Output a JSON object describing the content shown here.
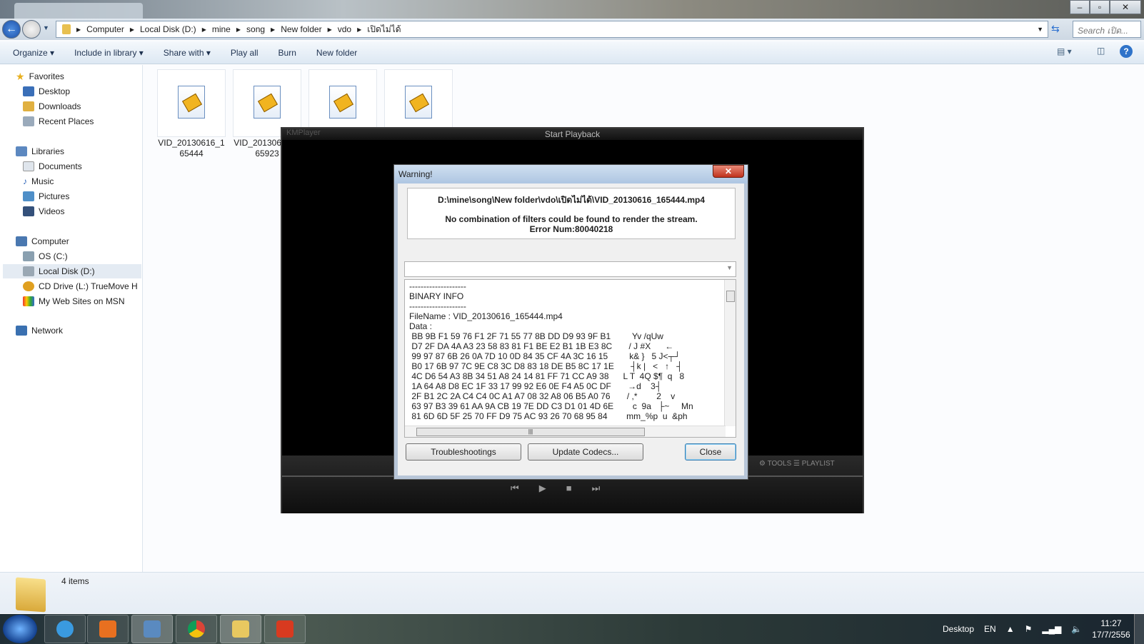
{
  "window": {
    "controls": [
      "minimize",
      "maximize",
      "close"
    ]
  },
  "nav": {
    "breadcrumb": [
      "Computer",
      "Local Disk (D:)",
      "mine",
      "song",
      "New folder",
      "vdo",
      "เปิดไม่ได้"
    ],
    "search_placeholder": "Search เปิด..."
  },
  "toolbar": {
    "organize": "Organize ▾",
    "include": "Include in library ▾",
    "share": "Share with ▾",
    "play_all": "Play all",
    "burn": "Burn",
    "new_folder": "New folder"
  },
  "sidebar": {
    "favorites": "Favorites",
    "desktop": "Desktop",
    "downloads": "Downloads",
    "recent": "Recent Places",
    "libraries": "Libraries",
    "documents": "Documents",
    "music": "Music",
    "pictures": "Pictures",
    "videos": "Videos",
    "computer": "Computer",
    "os": "OS (C:)",
    "local_d": "Local Disk (D:)",
    "cd": "CD Drive (L:) TrueMove H",
    "msn": "My Web Sites on MSN",
    "network": "Network"
  },
  "files": [
    "VID_20130616_165444",
    "VID_20130616_165923",
    "",
    ""
  ],
  "kmplayer": {
    "logo": "KMPlayer",
    "title": "Start Playback",
    "tools": "⚙ TOOLS  ☰ PLAYLIST"
  },
  "dialog": {
    "title": "Warning!",
    "path": "D:\\mine\\song\\New folder\\vdo\\เปิดไม่ได้\\VID_20130616_165444.mp4",
    "message": "No combination of filters could be found to render the stream.",
    "error": "Error Num:80040218",
    "log": "--------------------\nBINARY INFO\n--------------------\nFileName : VID_20130616_165444.mp4\nData :\n BB 9B F1 59 76 F1 2F 71 55 77 8B DD D9 93 9F B1         Yv /qUw\n D7 2F DA 4A A3 23 58 83 81 F1 BE E2 B1 1B E3 8C       / J #X      ←\n 99 97 87 6B 26 0A 7D 10 0D 84 35 CF 4A 3C 16 15         k& }   5 J<┬┘\n B0 17 6B 97 7C 9E C8 3C D8 83 18 DE B5 8C 17 1E       ┤k |   <   ↑   ┤\n 4C D6 54 A3 8B 34 51 A8 24 14 81 FF 71 CC A9 38      L T  4Q $¶  q   8\n 1A 64 A8 D8 EC 1F 33 17 99 92 E6 0E F4 A5 0C DF       →d    3┤\n 2F B1 2C 2A C4 C4 0C A1 A7 08 32 A8 06 B5 A0 76       / ,*        2    v\n 63 97 B3 39 61 AA 9A CB 19 7E DD C3 D1 01 4D 6E        c  9a   ├~     Mn\n 81 6D 6D 5F 25 70 FF D9 75 AC 93 26 70 68 95 84        mm_%p  u  &ph",
    "troubleshoot": "Troubleshootings",
    "update": "Update Codecs...",
    "close": "Close"
  },
  "status": {
    "items": "4 items"
  },
  "taskbar": {
    "desktop": "Desktop",
    "lang": "EN",
    "time": "11:27",
    "date": "17/7/2556"
  }
}
